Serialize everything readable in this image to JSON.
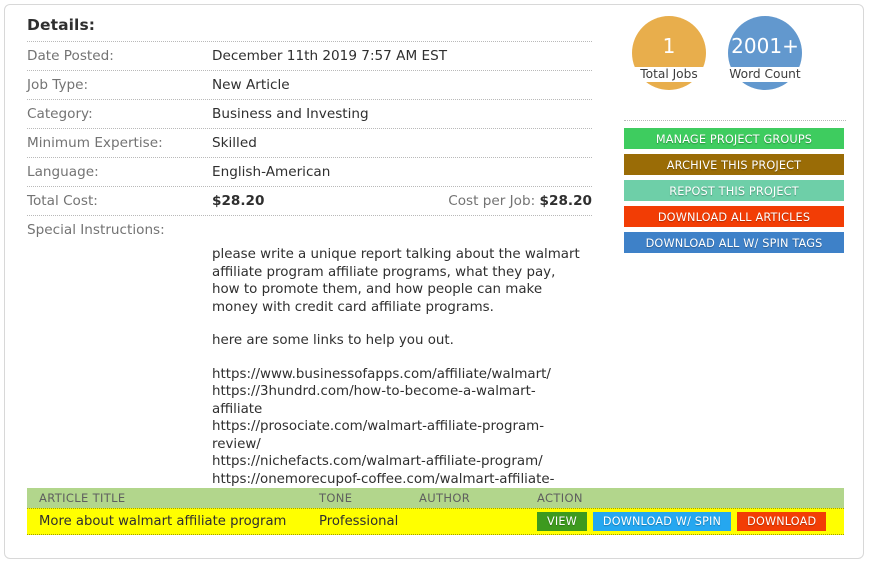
{
  "details": {
    "heading": "Details:",
    "rows": [
      {
        "label": "Date Posted:",
        "value": "December 11th 2019 7:57 AM EST",
        "bold": false
      },
      {
        "label": "Job Type:",
        "value": "New Article",
        "bold": false
      },
      {
        "label": "Category:",
        "value": "Business and Investing",
        "bold": false
      },
      {
        "label": "Minimum Expertise:",
        "value": "Skilled",
        "bold": false
      },
      {
        "label": "Language:",
        "value": "English-American",
        "bold": false
      }
    ],
    "total_cost_label": "Total Cost:",
    "total_cost_value": "$28.20",
    "cost_per_job_label": "Cost per Job:",
    "cost_per_job_value": "$28.20",
    "special_instructions_label": "Special Instructions:",
    "special_instructions_paragraph1": "please write a unique report talking about the walmart affiliate program affiliate programs, what they pay, how to promote them, and how people can make money with credit card affiliate programs.",
    "special_instructions_paragraph2": "here are some links to help you out.",
    "links": [
      "https://www.businessofapps.com/affiliate/walmart/",
      "https://3hundrd.com/how-to-become-a-walmart-affiliate",
      "https://prosociate.com/walmart-affiliate-program-review/",
      "https://nichefacts.com/walmart-affiliate-program/",
      "https://onemorecupof-coffee.com/walmart-affiliate-program-review/"
    ]
  },
  "badges": [
    {
      "number": "1",
      "label": "Total Jobs",
      "color": "#E8AE4C"
    },
    {
      "number": "2001+",
      "label": "Word Count",
      "color": "#6298CE"
    }
  ],
  "actions": [
    {
      "label": "MANAGE PROJECT GROUPS",
      "color": "#3ECC5F"
    },
    {
      "label": "ARCHIVE THIS PROJECT",
      "color": "#9A6C06"
    },
    {
      "label": "REPOST THIS PROJECT",
      "color": "#6ECFA8"
    },
    {
      "label": "DOWNLOAD ALL ARTICLES",
      "color": "#F23D05"
    },
    {
      "label": "DOWNLOAD ALL W/ SPIN TAGS",
      "color": "#3E81C8"
    }
  ],
  "articles_table": {
    "header_bg": "#B2D68C",
    "row_bg": "#FFFF00",
    "columns": [
      "ARTICLE TITLE",
      "TONE",
      "AUTHOR",
      "ACTION"
    ],
    "rows": [
      {
        "title": "More about walmart affiliate program",
        "tone": "Professional",
        "author": "",
        "actions": [
          {
            "label": "VIEW",
            "color": "#3D9A1E"
          },
          {
            "label": "DOWNLOAD W/ SPIN",
            "color": "#25A7F0"
          },
          {
            "label": "DOWNLOAD",
            "color": "#F23D05"
          }
        ]
      }
    ]
  }
}
